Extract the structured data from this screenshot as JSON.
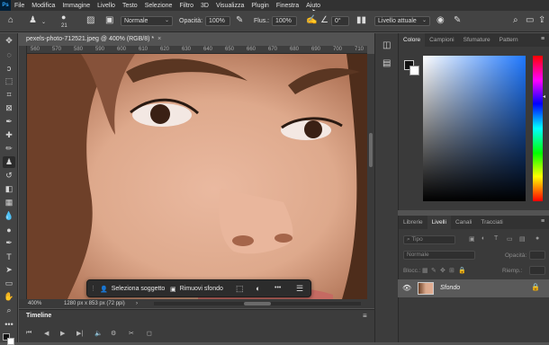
{
  "menubar": {
    "logo": "Ps",
    "items": [
      "File",
      "Modifica",
      "Immagine",
      "Livello",
      "Testo",
      "Selezione",
      "Filtro",
      "3D",
      "Visualizza",
      "Plugin",
      "Finestra",
      "Aiuto"
    ]
  },
  "options": {
    "brush_size": "21",
    "mode_value": "Normale",
    "opacity_label": "Opacità:",
    "opacity_value": "100%",
    "flow_label": "Flus.:",
    "flow_value": "100%",
    "angle_value": "0°",
    "sample_value": "Livello attuale"
  },
  "document": {
    "tab_title": "pexels-photo-712521.jpeg @ 400% (RGB/8) *",
    "close": "×",
    "ruler_ticks": [
      "560",
      "570",
      "580",
      "590",
      "600",
      "610",
      "620",
      "630",
      "640",
      "650",
      "660",
      "670",
      "680",
      "690",
      "700",
      "710"
    ],
    "zoom": "400%",
    "dimensions": "1280 px x 853 px (72 ppi)"
  },
  "taskbar": {
    "select_subject": "Seleziona soggetto",
    "remove_background": "Rimuovi sfondo",
    "more": "•••"
  },
  "timeline": {
    "title": "Timeline"
  },
  "color_panel": {
    "tabs": [
      "Colore",
      "Campioni",
      "Sfumature",
      "Pattern"
    ],
    "active_tab": 0,
    "foreground": "#111111",
    "background": "#ffffff",
    "hue_color": "#1f78ff"
  },
  "layers_panel": {
    "tabs": [
      "Librerie",
      "Livelli",
      "Canali",
      "Tracciati"
    ],
    "active_tab": 1,
    "filter_placeholder": "Tipo",
    "blend_mode": "Normale",
    "opacity_label": "Opacità:",
    "lock_label": "Blocc.:",
    "fill_label": "Riemp.:",
    "layer_name": "Sfondo"
  }
}
